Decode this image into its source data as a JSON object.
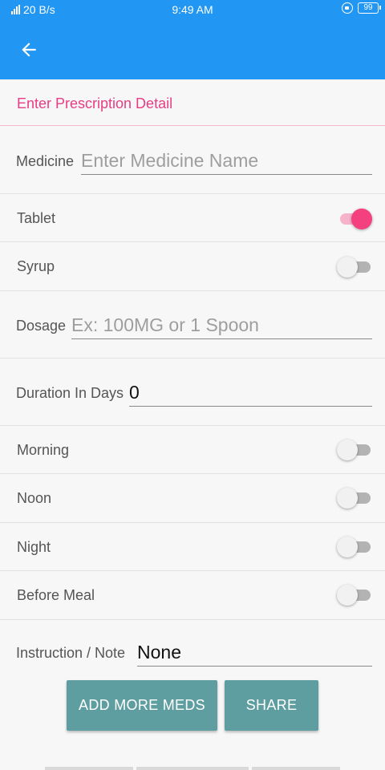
{
  "status_bar": {
    "network_speed": "20 B/s",
    "time": "9:49 AM",
    "battery": "99"
  },
  "app_bar": {
    "back_icon": "arrow-left-icon"
  },
  "section": {
    "title": "Enter Prescription Detail"
  },
  "form": {
    "medicine": {
      "label": "Medicine",
      "placeholder": "Enter Medicine Name",
      "value": ""
    },
    "tablet": {
      "label": "Tablet",
      "checked": true
    },
    "syrup": {
      "label": "Syrup",
      "checked": false
    },
    "dosage": {
      "label": "Dosage",
      "placeholder": "Ex: 100MG or 1 Spoon",
      "value": ""
    },
    "duration": {
      "label": "Duration In Days",
      "value": "0"
    },
    "morning": {
      "label": "Morning",
      "checked": false
    },
    "noon": {
      "label": "Noon",
      "checked": false
    },
    "night": {
      "label": "Night",
      "checked": false
    },
    "before_meal": {
      "label": "Before Meal",
      "checked": false
    },
    "instruction": {
      "label": "Instruction / Note",
      "value": "None"
    }
  },
  "buttons": {
    "add_more": "ADD MORE MEDS",
    "share": "SHARE"
  },
  "colors": {
    "primary": "#2196f3",
    "accent": "#f5407f",
    "button": "#5f9ea0"
  }
}
